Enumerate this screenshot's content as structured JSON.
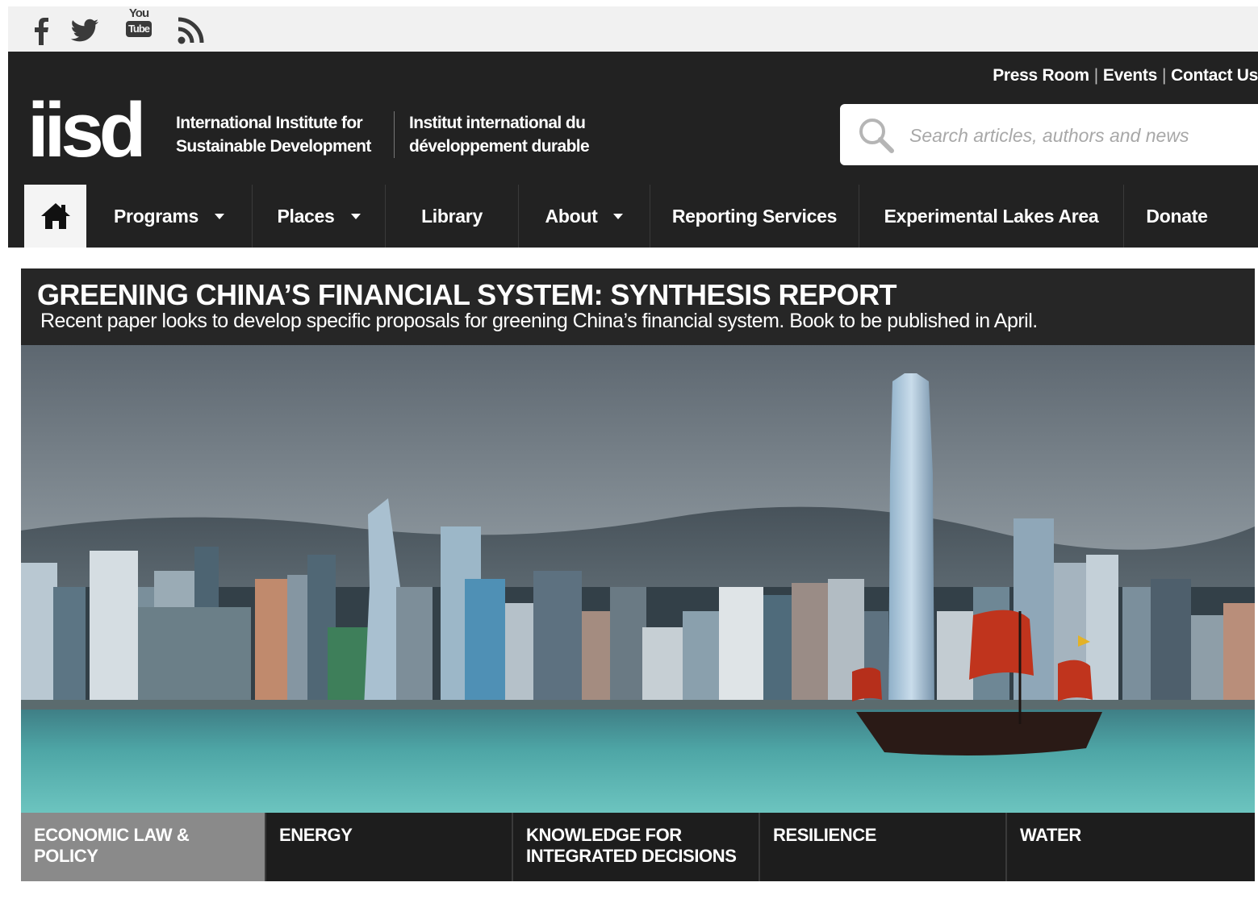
{
  "social": {
    "icons": [
      "facebook-icon",
      "twitter-icon",
      "youtube-icon",
      "rss-icon"
    ],
    "youtube_text": [
      "You",
      "Tube"
    ]
  },
  "header": {
    "top_links": [
      "Press Room",
      "Events",
      "Contact Us"
    ],
    "separator": "|",
    "logo": "iisd",
    "org_name_en": [
      "International Institute for",
      "Sustainable Development"
    ],
    "org_name_fr": [
      "Institut international du",
      "développement durable"
    ],
    "search_placeholder": "Search articles, authors and news"
  },
  "nav": {
    "home_icon": "home-icon",
    "items": [
      {
        "label": "Programs",
        "dropdown": true
      },
      {
        "label": "Places",
        "dropdown": true
      },
      {
        "label": "Library",
        "dropdown": false
      },
      {
        "label": "About",
        "dropdown": true
      },
      {
        "label": "Reporting Services",
        "dropdown": false
      },
      {
        "label": "Experimental Lakes Area",
        "dropdown": false
      },
      {
        "label": "Donate",
        "dropdown": false
      }
    ]
  },
  "hero": {
    "title": "GREENING CHINA’S FINANCIAL SYSTEM: SYNTHESIS REPORT",
    "subtitle": "Recent paper looks to develop specific proposals for greening China’s financial system. Book to be published in April."
  },
  "topics": [
    {
      "lines": [
        "ECONOMIC LAW &",
        "POLICY"
      ],
      "active": true
    },
    {
      "lines": [
        "ENERGY"
      ],
      "active": false
    },
    {
      "lines": [
        "KNOWLEDGE FOR",
        "INTEGRATED DECISIONS"
      ],
      "active": false
    },
    {
      "lines": [
        "RESILIENCE"
      ],
      "active": false
    },
    {
      "lines": [
        "WATER"
      ],
      "active": false
    }
  ],
  "colors": {
    "header_bg": "#222222",
    "social_bg": "#f1f1f1",
    "active_topic": "#8a8a8a",
    "junk_sail": "#c0341d"
  }
}
